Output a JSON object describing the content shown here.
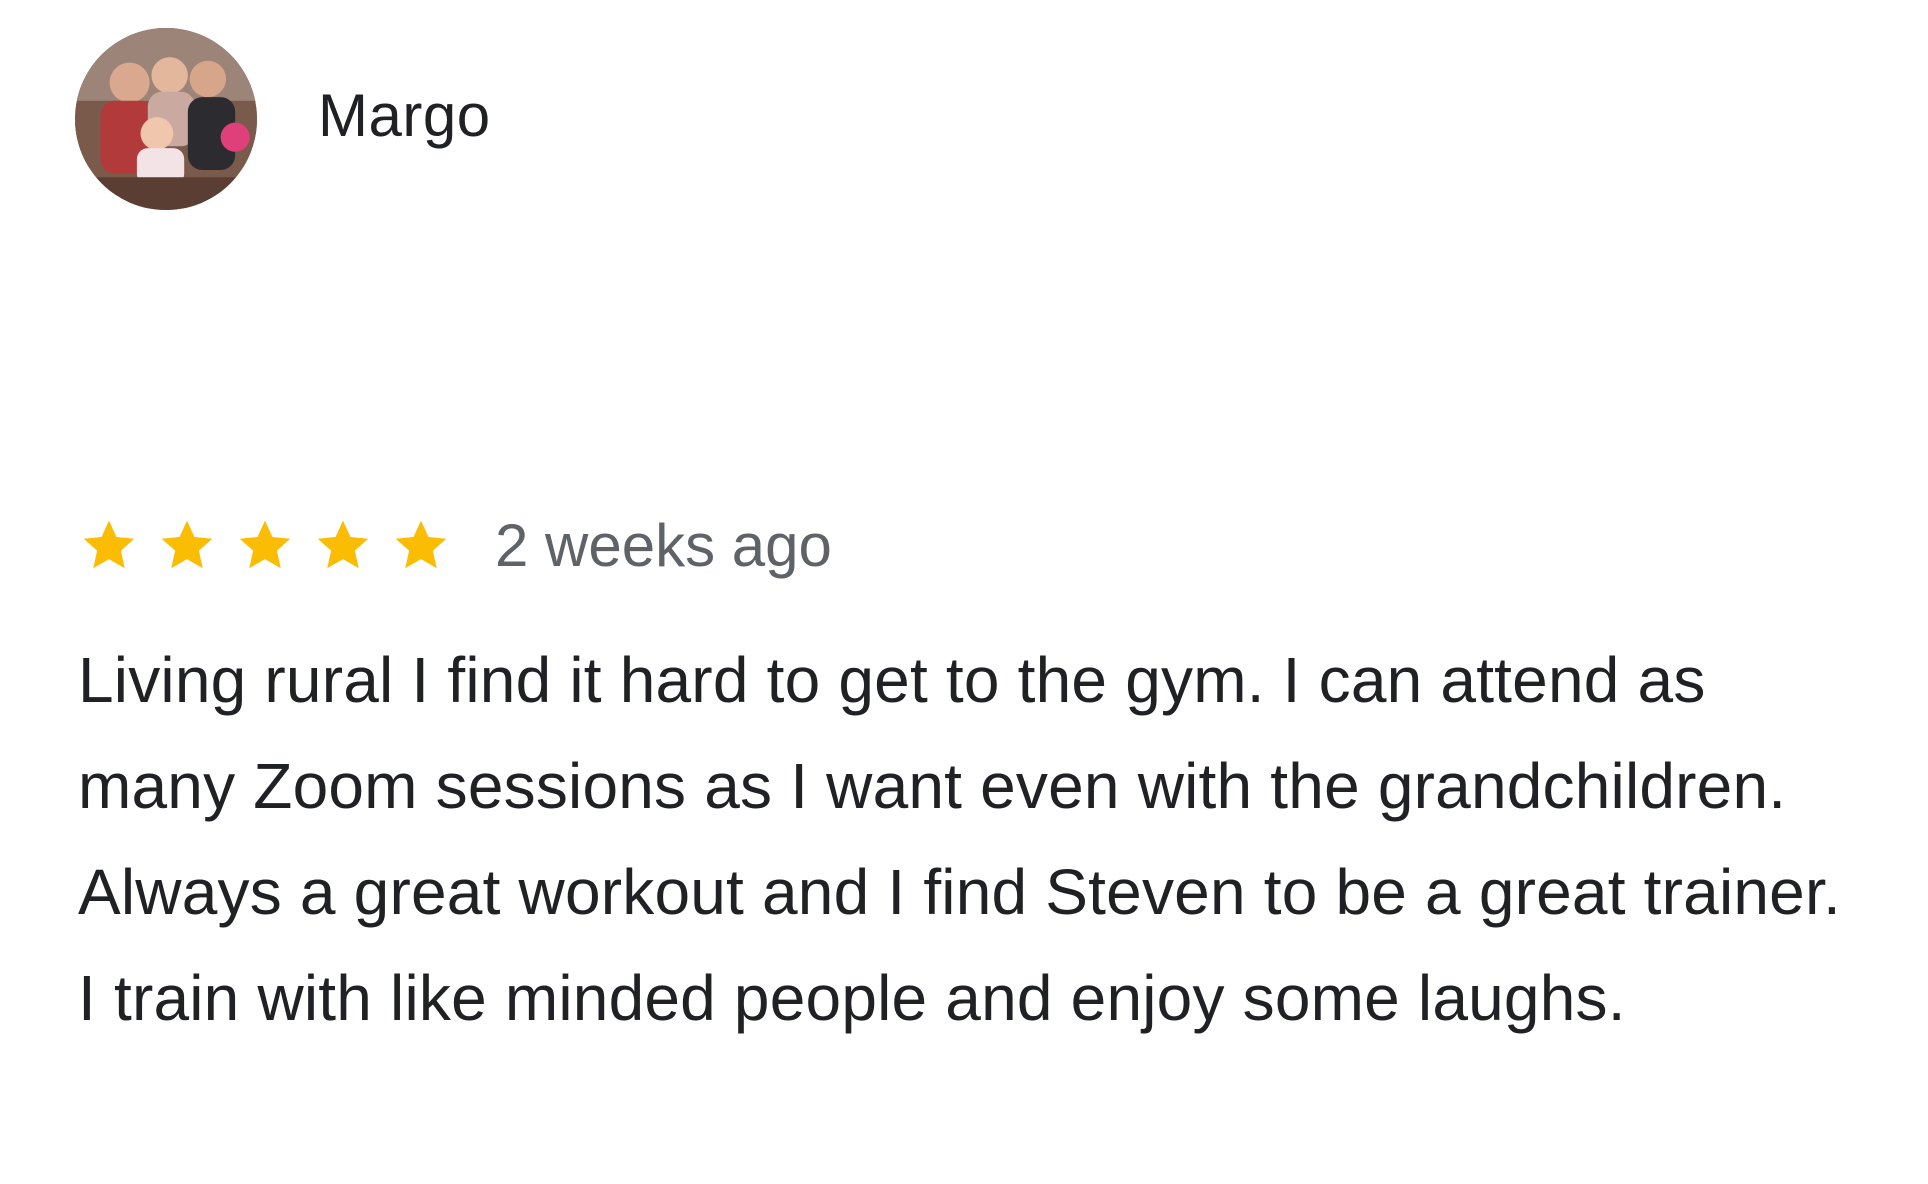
{
  "reviewer": {
    "name": "Margo",
    "avatar_icon": "profile-photo-avatar"
  },
  "rating": {
    "stars": 5,
    "max_stars": 5,
    "star_color": "#FBBC04",
    "date": "2 weeks ago"
  },
  "review": {
    "text": "Living rural I find it hard to get to the gym. I can attend as many Zoom sessions as I want even with the grandchildren. Always a great workout and I find Steven to be a great trainer. I train with like minded people and enjoy some laughs."
  },
  "colors": {
    "text_primary": "#202124",
    "text_secondary": "#5f6368",
    "background": "#ffffff"
  }
}
